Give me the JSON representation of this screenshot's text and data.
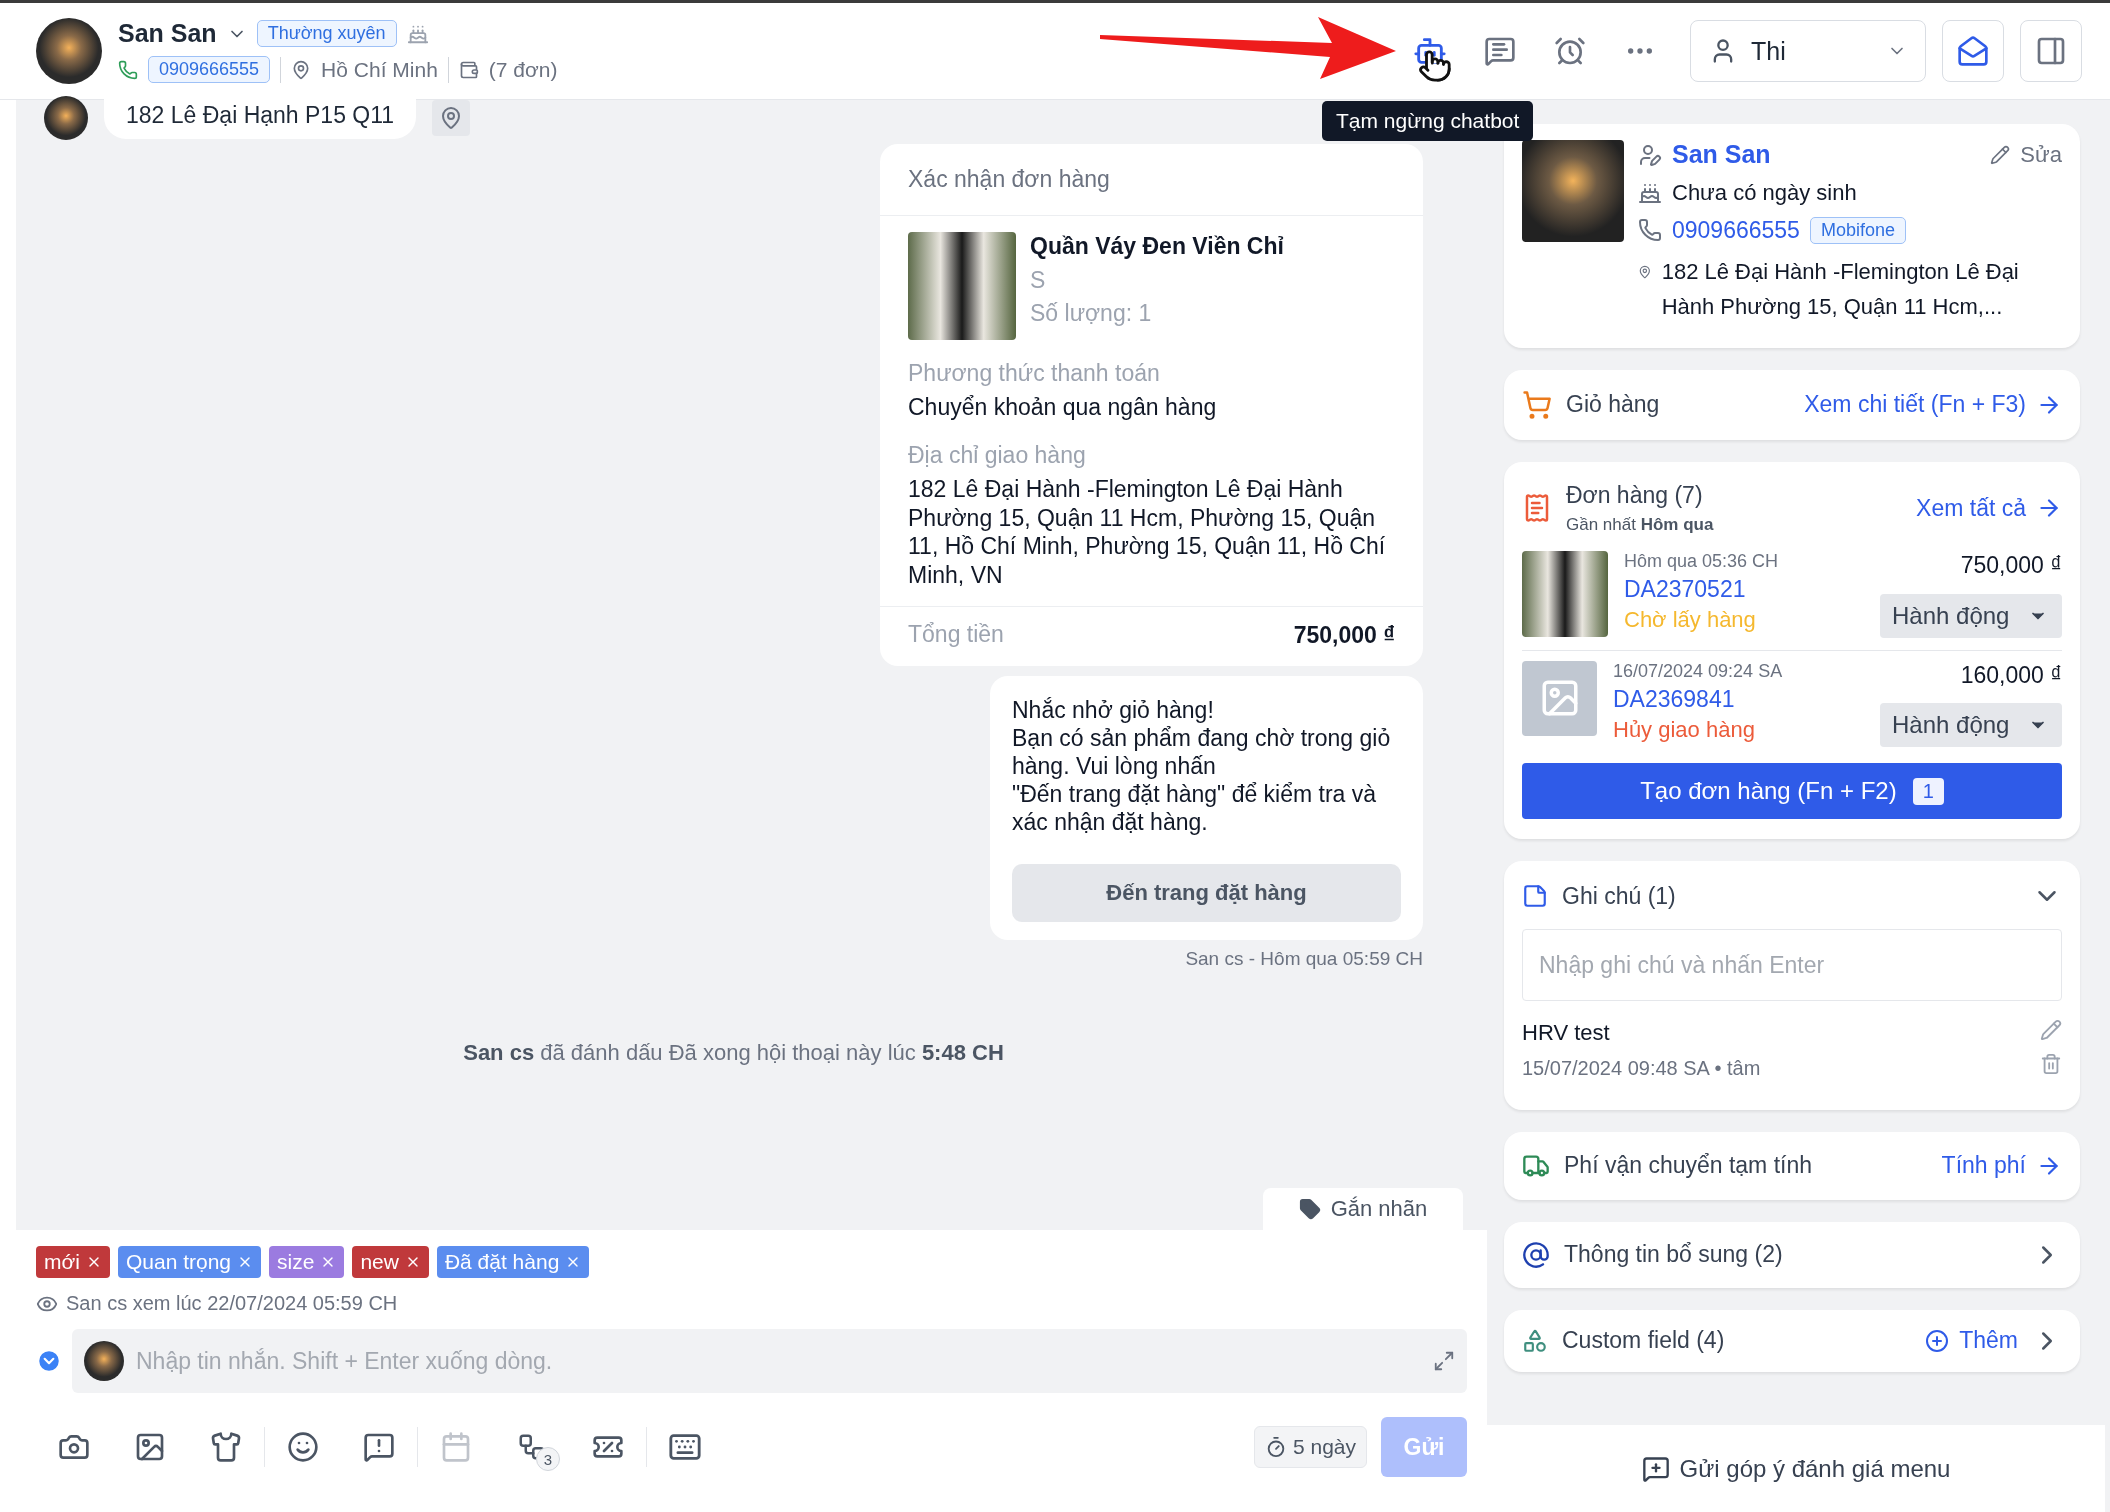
{
  "header": {
    "name": "San San",
    "tag": "Thường xuyên",
    "phone": "0909666555",
    "location": "Hồ Chí Minh",
    "orders_count": "(7 đơn)"
  },
  "toolbar": {
    "assignee": "Thi",
    "tooltip": "Tạm ngừng chatbot"
  },
  "chat": {
    "previous_message": "182 Lê Đại Hạnh P15 Q11",
    "order_card": {
      "title": "Xác nhận đơn hàng",
      "product_name": "Quần Váy Đen Viền Chỉ",
      "variant": "S",
      "quantity": "Số lượng: 1",
      "payment_label": "Phương thức thanh toán",
      "payment_value": "Chuyển khoản qua ngân hàng",
      "address_label": "Địa chỉ giao hàng",
      "address_value": "182 Lê Đại Hành -Flemington Lê Đại Hành Phường 15, Quận 11 Hcm, Phường 15, Quận 11, Hồ Chí Minh, Phường 15, Quận 11, Hồ Chí Minh, VN",
      "total_label": "Tổng tiền",
      "total_value": "750,000 ₫"
    },
    "reminder": {
      "text": "Nhắc nhở giỏ hàng!\nBạn có sản phẩm đang chờ trong giỏ hàng. Vui lòng nhấn\n\"Đến trang đặt hàng\" để kiểm tra và xác nhận đặt hàng.",
      "button": "Đến trang đặt hàng"
    },
    "meta": "San cs - Hôm qua 05:59 CH",
    "system_note": "**San cs** đã đánh dấu Đã xong hội thoại này lúc **5:48 CH**"
  },
  "label_button": "Gắn nhãn",
  "tags": [
    {
      "label": "mới",
      "color": "#c0393b"
    },
    {
      "label": "Quan trọng",
      "color": "#5b8def"
    },
    {
      "label": "size",
      "color": "#9b7be0"
    },
    {
      "label": "new",
      "color": "#c0393b"
    },
    {
      "label": "Đã đặt hàng",
      "color": "#5b8def"
    }
  ],
  "seen": "San cs xem lúc 22/07/2024 05:59 CH",
  "composer": {
    "placeholder": "Nhập tin nhắn. Shift + Enter xuống dòng.",
    "flow_badge": "3",
    "expiry": "5 ngày",
    "send": "Gửi",
    "send_disabled": true
  },
  "customer": {
    "name": "San San",
    "edit": "Sửa",
    "birthday": "Chưa có ngày sinh",
    "phone": "0909666555",
    "carrier": "Mobifone",
    "address": "182 Lê Đại Hành -Flemington Lê Đại Hành Phường 15, Quận 11 Hcm,..."
  },
  "cart": {
    "title": "Giỏ hàng",
    "link": "Xem chi tiết (Fn + F3)"
  },
  "orders": {
    "title": "Đơn hàng (7)",
    "recent": "Gần nhất **Hôm qua**",
    "link": "Xem tất cả",
    "create_button": "Tạo đơn hàng (Fn + F2)",
    "create_badge": "1",
    "items": [
      {
        "time": "Hôm qua 05:36 CH",
        "code": "DA2370521",
        "status": "Chờ lấy hàng",
        "color": "#f5b82e",
        "price": "750,000 ₫",
        "action": "Hành động",
        "kind": "photo"
      },
      {
        "time": "16/07/2024 09:24 SA",
        "code": "DA2369841",
        "status": "Hủy giao hàng",
        "color": "#ec5b3a",
        "price": "160,000 ₫",
        "action": "Hành động",
        "kind": "empty"
      }
    ]
  },
  "notes": {
    "title": "Ghi chú (1)",
    "expanded": true,
    "placeholder": "Nhập ghi chú và nhấn Enter",
    "items": [
      {
        "text": "HRV test",
        "meta": "15/07/2024 09:48 SA • tâm"
      }
    ]
  },
  "shipping": {
    "title": "Phí vận chuyển tạm tính",
    "link": "Tính phí"
  },
  "extra": {
    "title": "Thông tin bổ sung (2)"
  },
  "custom_field": {
    "title": "Custom field (4)",
    "add": "Thêm"
  },
  "feedback": "Gửi góp ý đánh giá menu"
}
